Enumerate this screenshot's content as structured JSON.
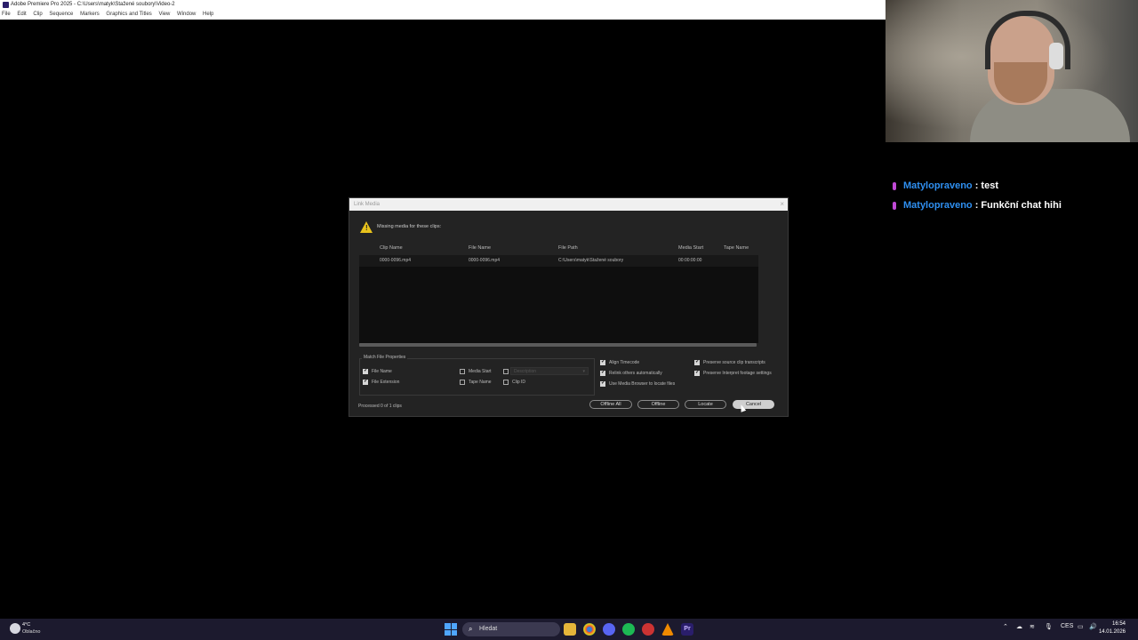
{
  "window": {
    "title": "Adobe Premiere Pro 2025 - C:\\Users\\matyk\\Stažené soubory\\Video-2",
    "menu": [
      "File",
      "Edit",
      "Clip",
      "Sequence",
      "Markers",
      "Graphics and Titles",
      "View",
      "Window",
      "Help"
    ]
  },
  "chat": [
    {
      "user": "Matylopraveno",
      "message": ": test"
    },
    {
      "user": "Matylopraveno",
      "message": ": Funkční chat hihi"
    }
  ],
  "dialog": {
    "title": "Link Media",
    "close": "×",
    "message": "Missing media for these clips:",
    "columns": [
      "Clip Name",
      "File Name",
      "File Path",
      "Media Start",
      "Tape Name"
    ],
    "rows": [
      {
        "clip_name": "0000-0096.mp4",
        "file_name": "0000-0096.mp4",
        "file_path": "C:\\Users\\matyk\\Stažené soubory",
        "media_start": "00:00:00:00",
        "tape_name": ""
      }
    ],
    "match_group_label": "Match File Properties",
    "match_options": {
      "file_name": {
        "label": "File Name",
        "checked": true
      },
      "file_extension": {
        "label": "File Extension",
        "checked": true
      },
      "media_start": {
        "label": "Media Start",
        "checked": false
      },
      "tape_name": {
        "label": "Tape Name",
        "checked": false
      },
      "description": {
        "label": "Description",
        "checked": false
      },
      "clip_id": {
        "label": "Clip ID",
        "checked": false
      }
    },
    "options": {
      "align_timecode": {
        "label": "Align Timecode",
        "checked": true
      },
      "relink_others": {
        "label": "Relink others automatically",
        "checked": true
      },
      "use_media_browser": {
        "label": "Use Media Browser to locate files",
        "checked": true
      },
      "preserve_transcripts": {
        "label": "Preserve source clip transcripts",
        "checked": true
      },
      "preserve_interpret": {
        "label": "Preserve Interpret footage settings",
        "checked": true
      }
    },
    "processed": "Processed 0 of 1 clips",
    "buttons": {
      "offline_all": "Offline All",
      "offline": "Offline",
      "locate": "Locate",
      "cancel": "Cancel"
    }
  },
  "taskbar": {
    "weather_temp": "4°C",
    "weather_desc": "Oblačno",
    "search_placeholder": "Hledat",
    "apps": [
      "file-explorer-icon",
      "chrome-icon",
      "discord-icon",
      "spotify-icon",
      "app-icon",
      "vlc-icon",
      "premiere-icon"
    ],
    "premiere_label": "Pr",
    "language": "CES",
    "time": "16:54",
    "date": "14.01.2026"
  }
}
